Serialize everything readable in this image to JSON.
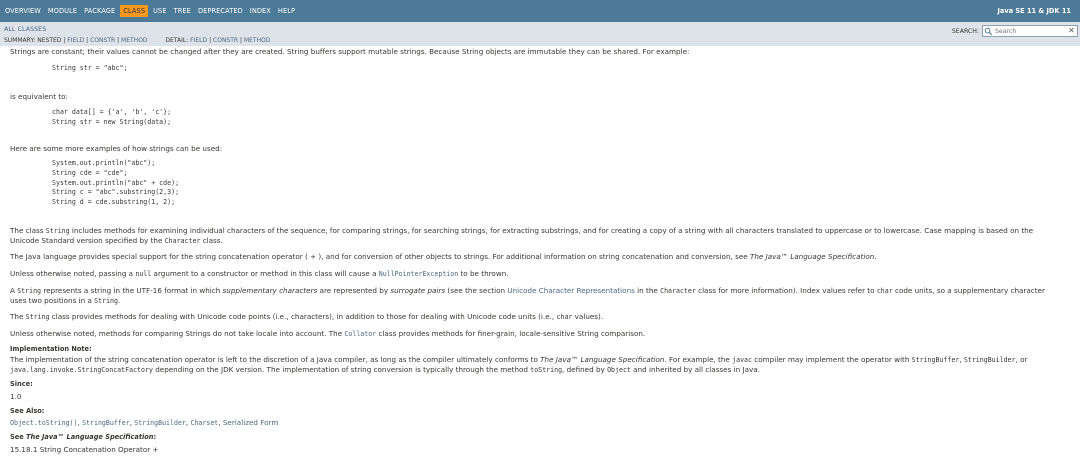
{
  "topnav": {
    "items": [
      "OVERVIEW",
      "MODULE",
      "PACKAGE",
      "CLASS",
      "USE",
      "TREE",
      "DEPRECATED",
      "INDEX",
      "HELP"
    ],
    "active": "CLASS",
    "brand": "Java SE 11 & JDK 11"
  },
  "subnav": {
    "all_classes": "ALL CLASSES",
    "summary_label": "SUMMARY: NESTED |",
    "summary_field": "FIELD",
    "summary_constr": "CONSTR",
    "summary_method": "METHOD",
    "detail_label": "DETAIL:",
    "detail_field": "FIELD",
    "detail_constr": "CONSTR",
    "detail_method": "METHOD",
    "sep": "|",
    "search_label": "SEARCH:",
    "search_placeholder": "Search"
  },
  "content": {
    "p1": "Strings are constant; their values cannot be changed after they are created. String buffers support mutable strings. Because String objects are immutable they can be shared. For example:",
    "code1": "String str = \"abc\";",
    "p2": "is equivalent to:",
    "code2": "char data[] = {'a', 'b', 'c'};\nString str = new String(data);",
    "p3": "Here are some more examples of how strings can be used:",
    "code3": "System.out.println(\"abc\");\nString cde = \"cde\";\nSystem.out.println(\"abc\" + cde);\nString c = \"abc\".substring(2,3);\nString d = cde.substring(1, 2);",
    "p4_a": "The class ",
    "p4_code": "String",
    "p4_b": " includes methods for examining individual characters of the sequence, for comparing strings, for searching strings, for extracting substrings, and for creating a copy of a string with all characters translated to uppercase or to lowercase. Case mapping is based on the Unicode Standard version specified by the ",
    "p4_code2": "Character",
    "p4_c": " class.",
    "p5_a": "The Java language provides special support for the string concatenation operator ( + ), and for conversion of other objects to strings. For additional information on string concatenation and conversion, see ",
    "p5_link": "The Java™ Language Specification",
    "p5_b": ".",
    "p6_a": "Unless otherwise noted, passing a ",
    "p6_code": "null",
    "p6_b": " argument to a constructor or method in this class will cause a ",
    "p6_link": "NullPointerException",
    "p6_c": " to be thrown.",
    "p7_a": "A ",
    "p7_code": "String",
    "p7_b": " represents a string in the UTF-16 format in which ",
    "p7_em1": "supplementary characters",
    "p7_c": " are represented by ",
    "p7_em2": "surrogate pairs",
    "p7_d": " (see the section ",
    "p7_link": "Unicode Character Representations",
    "p7_e": " in the ",
    "p7_code2": "Character",
    "p7_f": " class for more information). Index values refer to ",
    "p7_code3": "char",
    "p7_g": " code units, so a supplementary character uses two positions in a ",
    "p7_code4": "String",
    "p7_h": ".",
    "p8_a": "The ",
    "p8_code": "String",
    "p8_b": " class provides methods for dealing with Unicode code points (i.e., characters), in addition to those for dealing with Unicode code units (i.e., ",
    "p8_code2": "char",
    "p8_c": " values).",
    "p9_a": "Unless otherwise noted, methods for comparing Strings do not take locale into account. The ",
    "p9_link": "Collator",
    "p9_b": " class provides methods for finer-grain, locale-sensitive String comparison.",
    "impl_heading": "Implementation Note:",
    "impl_a": "The implementation of the string concatenation operator is left to the discretion of a Java compiler, as long as the compiler ultimately conforms to ",
    "impl_em": "The Java™ Language Specification",
    "impl_b": ". For example, the ",
    "impl_code1": "javac",
    "impl_c": " compiler may implement the operator with ",
    "impl_code2": "StringBuffer",
    "impl_d": ", ",
    "impl_code3": "StringBuilder",
    "impl_e": ", or ",
    "impl_code4": "java.lang.invoke.StringConcatFactory",
    "impl_f": " depending on the JDK version. The implementation of string conversion is typically through the method ",
    "impl_code5": "toString",
    "impl_g": ", defined by ",
    "impl_code6": "Object",
    "impl_h": " and inherited by all classes in Java.",
    "since_heading": "Since:",
    "since_value": "1.0",
    "seealso_heading": "See Also:",
    "seealso_1": "Object.toString()",
    "seealso_2": "StringBuffer",
    "seealso_3": "StringBuilder",
    "seealso_4": "Charset",
    "seealso_5": "Serialized Form",
    "comma": ", ",
    "jls_heading_a": "See ",
    "jls_heading_em": "The Java™ Language Specification",
    "jls_heading_b": ":",
    "jls_value": "15.18.1 String Concatenation Operator +"
  },
  "colors": {
    "topnav_bg": "#4d7a97",
    "active_tab_bg": "#f8981d",
    "subnav_bg": "#dee3e9",
    "link": "#4a6782",
    "text": "#353833"
  }
}
